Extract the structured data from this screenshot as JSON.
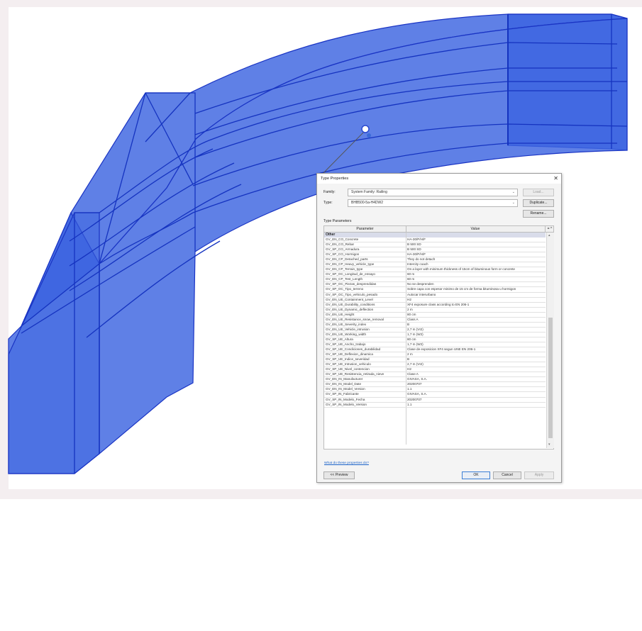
{
  "viewport": {
    "model": "barrier-3d-view"
  },
  "colors": {
    "model_fill": "#3c64e0",
    "model_edge": "#1a34c4",
    "dialog_bg": "#f4f4f4",
    "accent": "#1a62c9"
  },
  "dialog": {
    "title": "Type Properties",
    "close_symbol": "✕",
    "family_label": "Family:",
    "family_value": "System Family: Railing",
    "type_label": "Type:",
    "type_value": "BHB500-5a-H4DW2",
    "load_button": "Load...",
    "duplicate_button": "Duplicate...",
    "rename_button": "Rename...",
    "type_parameters_label": "Type Parameters",
    "col_parameter": "Parameter",
    "col_value": "Value",
    "col_eq": "= ^",
    "group_other": "Other",
    "rows": [
      {
        "param": "GV_EN_CO_Concrete",
        "value": "HA-30/P/H/F"
      },
      {
        "param": "GV_EN_CO_Rebar",
        "value": "B 500 SD"
      },
      {
        "param": "GV_SP_CO_Armadura",
        "value": "B 500 SD"
      },
      {
        "param": "GV_SP_CO_Hormigon",
        "value": "HA-30/P/H/F"
      },
      {
        "param": "GV_EN_CP_Detached_parts",
        "value": "They do not detach"
      },
      {
        "param": "GV_EN_CP_Heavy_vehicle_type",
        "value": "Intercity coach"
      },
      {
        "param": "GV_EN_CP_Terrain_type",
        "value": "On a layer with minimum thickness of 15cm of bituminous form or concrete"
      },
      {
        "param": "GV_SP_OC_Longitud_de_ensayo",
        "value": "60 m"
      },
      {
        "param": "GV_EN_CP_Test_Length",
        "value": "60 m"
      },
      {
        "param": "GV_SP_OC_Piezas_desprendidas",
        "value": "No se desprenden"
      },
      {
        "param": "GV_SP_OC_Tipo_terreno",
        "value": "Sobre capa con espesor minimo de 15 cm de forma bituminosa u hormigon"
      },
      {
        "param": "GV_SP_OC_Tipo_vehiculo_pesado",
        "value": "Autocar interurbano"
      },
      {
        "param": "GV_EN_UE_Containment_Level",
        "value": "H2"
      },
      {
        "param": "GV_EN_UE_Durability_conditions",
        "value": "XF4 exposure class according to EN 206-1"
      },
      {
        "param": "GV_EN_UE_Dynamic_deflection",
        "value": "2 m"
      },
      {
        "param": "GV_EN_UE_Height",
        "value": "80 cm"
      },
      {
        "param": "GV_EN_UE_Resistance_snow_removal",
        "value": "Class A"
      },
      {
        "param": "GV_EN_UE_Severity_index",
        "value": "B"
      },
      {
        "param": "GV_EN_UE_Vehicle_intrusion",
        "value": "2,7 m (VI2)"
      },
      {
        "param": "GV_EN_UE_Working_width",
        "value": "1,7 m (W2)"
      },
      {
        "param": "GV_SP_UE_Altura",
        "value": "80 cm"
      },
      {
        "param": "GV_SP_UE_Ancho_trabajo",
        "value": "1,7 m (W2)"
      },
      {
        "param": "GV_SP_UE_Condiciones_durabilidad",
        "value": "Clase de exposicion XF4 segun UNE EN 206-1"
      },
      {
        "param": "GV_SP_UE_Deflexion_dinamica",
        "value": "2 m"
      },
      {
        "param": "GV_SP_UE_Indice_severidad",
        "value": "B"
      },
      {
        "param": "GV_SP_UE_Intrusion_vehiculo",
        "value": "2,7 m (VI2)"
      },
      {
        "param": "GV_SP_UE_Nivel_contencion",
        "value": "H2"
      },
      {
        "param": "GV_SP_UE_Resistencia_retirada_nieve",
        "value": "Clase A"
      },
      {
        "param": "GV_EN_IN_Manufacturer",
        "value": "GIVASA, S.A."
      },
      {
        "param": "GV_EN_IN_Model_Date",
        "value": "20200707"
      },
      {
        "param": "GV_EN_IN_Model_Version",
        "value": "1.1"
      },
      {
        "param": "GV_SP_IN_Fabricante",
        "value": "GIVASA, S.A."
      },
      {
        "param": "GV_SP_IN_Modelo_Fecha",
        "value": "20200707"
      },
      {
        "param": "GV_SP_IN_Modelo_Version",
        "value": "1.1"
      }
    ],
    "help_link": "What do these properties do?",
    "preview_button": "<< Preview",
    "ok_button": "OK",
    "cancel_button": "Cancel",
    "apply_button": "Apply"
  }
}
